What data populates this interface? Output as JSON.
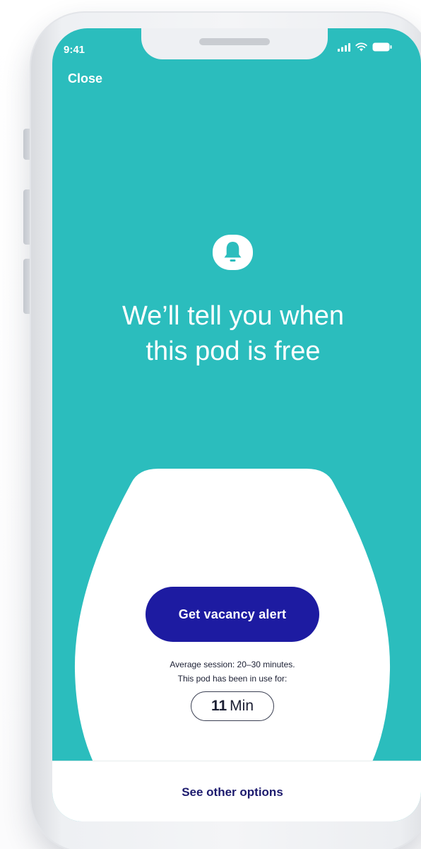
{
  "status_bar": {
    "time": "9:41",
    "icons": [
      "cellular-signal-icon",
      "wifi-icon",
      "battery-icon"
    ]
  },
  "header": {
    "close_label": "Close"
  },
  "main": {
    "icon": "bell-icon",
    "headline_line1": "We’ll tell you when",
    "headline_line2": "this pod is free",
    "alert_button_label": "Get vacancy alert",
    "session_line1": "Average session: 20–30 minutes.",
    "session_line2": "This pod has been in use for:",
    "timer_value": "11",
    "timer_unit": "Min"
  },
  "footer": {
    "other_options_label": "See other options"
  },
  "colors": {
    "background_teal": "#2bbdbd",
    "button_navy": "#1d1ba1",
    "link_navy": "#1d1b6e",
    "white": "#ffffff"
  }
}
